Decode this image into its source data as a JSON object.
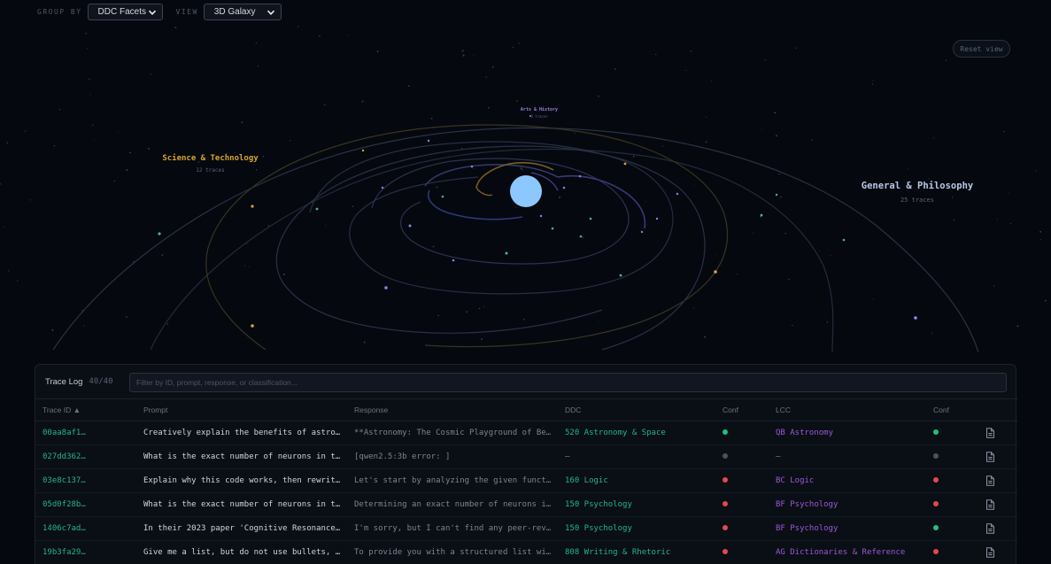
{
  "toolbar": {
    "group_by_label": "GROUP BY",
    "group_by_value": "DDC Facets",
    "view_label": "VIEW",
    "view_value": "3D Galaxy",
    "reset_label": "Reset view"
  },
  "galaxy": {
    "core_color": "#8cc8ff",
    "clusters": [
      {
        "name": "Science & Technology",
        "count": "12 traces",
        "color": "#d8a52f"
      },
      {
        "name": "Arts & History",
        "count": "3 traces",
        "color": "#9a83d8"
      },
      {
        "name": "General & Philosophy",
        "count": "25 traces",
        "color": "#b9c7e6"
      }
    ]
  },
  "trace_log": {
    "title": "Trace Log",
    "count": "40/40",
    "filter_placeholder": "Filter by ID, prompt, response, or classification...",
    "columns": {
      "id": "Trace ID ▲",
      "prompt": "Prompt",
      "response": "Response",
      "ddc": "DDC",
      "ddc_conf": "Conf",
      "lcc": "LCC",
      "lcc_conf": "Conf"
    },
    "rows": [
      {
        "id": "00aa8af1…",
        "prompt": "Creatively explain the benefits of astro…",
        "response": "**Astronomy: The Cosmic Playground of Be…",
        "ddc": "520 Astronomy & Space",
        "ddc_conf": "#22c07a",
        "lcc": "QB Astronomy",
        "lcc_conf": "#22c07a"
      },
      {
        "id": "027dd362…",
        "prompt": "What is the exact number of neurons in t…",
        "response": "[qwen2.5:3b error: ]",
        "ddc": "—",
        "ddc_conf": "#4a5260",
        "lcc": "—",
        "lcc_conf": "#4a5260"
      },
      {
        "id": "03e8c137…",
        "prompt": "Explain why this code works, then rewrit…",
        "response": "Let's start by analyzing the given funct…",
        "ddc": "160 Logic",
        "ddc_conf": "#e5484d",
        "lcc": "BC Logic",
        "lcc_conf": "#e5484d"
      },
      {
        "id": "05d0f28b…",
        "prompt": "What is the exact number of neurons in t…",
        "response": "Determining an exact number of neurons i…",
        "ddc": "150 Psychology",
        "ddc_conf": "#e5484d",
        "lcc": "BF Psychology",
        "lcc_conf": "#e5484d"
      },
      {
        "id": "1406c7ad…",
        "prompt": "In their 2023 paper 'Cognitive Resonance…",
        "response": "I'm sorry, but I can't find any peer-rev…",
        "ddc": "150 Psychology",
        "ddc_conf": "#e5484d",
        "lcc": "BF Psychology",
        "lcc_conf": "#22c07a"
      },
      {
        "id": "19b3fa29…",
        "prompt": "Give me a list, but do not use bullets, …",
        "response": "To provide you with a structured list wi…",
        "ddc": "808 Writing & Rhetoric",
        "ddc_conf": "#e5484d",
        "lcc": "AG Dictionaries & Reference",
        "lcc_conf": "#e5484d"
      }
    ]
  }
}
